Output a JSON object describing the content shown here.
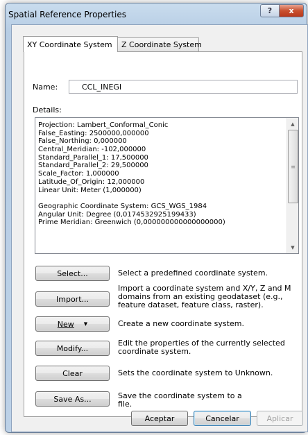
{
  "window": {
    "title": "Spatial Reference Properties"
  },
  "titlebar": {
    "help_label": "?",
    "close_label": "x"
  },
  "tabs": [
    {
      "label": "XY Coordinate System"
    },
    {
      "label": "Z Coordinate System"
    }
  ],
  "name": {
    "label": "Name:",
    "value": "CCL_INEGI"
  },
  "details": {
    "label": "Details:",
    "lines": [
      "Projection: Lambert_Conformal_Conic",
      "False_Easting: 2500000,000000",
      "False_Northing: 0,000000",
      "Central_Meridian: -102,000000",
      "Standard_Parallel_1: 17,500000",
      "Standard_Parallel_2: 29,500000",
      "Scale_Factor: 1,000000",
      "Latitude_Of_Origin: 12,000000",
      "Linear Unit: Meter (1,000000)",
      "",
      "Geographic Coordinate System: GCS_WGS_1984",
      "Angular Unit: Degree (0,0174532925199433)",
      "Prime Meridian: Greenwich (0,000000000000000000)"
    ]
  },
  "actions": {
    "select": {
      "label": "Select...",
      "desc": "Select a predefined coordinate system."
    },
    "import": {
      "label": "Import...",
      "desc": "Import a coordinate system and X/Y, Z and M domains from an existing geodataset (e.g., feature dataset, feature class, raster)."
    },
    "new": {
      "label": "New",
      "desc": "Create a new coordinate system."
    },
    "modify": {
      "label": "Modify...",
      "desc": "Edit the properties of the currently selected coordinate system."
    },
    "clear": {
      "label": "Clear",
      "desc": "Sets the coordinate system to Unknown."
    },
    "save_as": {
      "label": "Save As...",
      "desc": "Save the coordinate system to a file."
    }
  },
  "footer": {
    "accept_label": "Aceptar",
    "cancel_label": "Cancelar",
    "apply_label": "Aplicar"
  }
}
